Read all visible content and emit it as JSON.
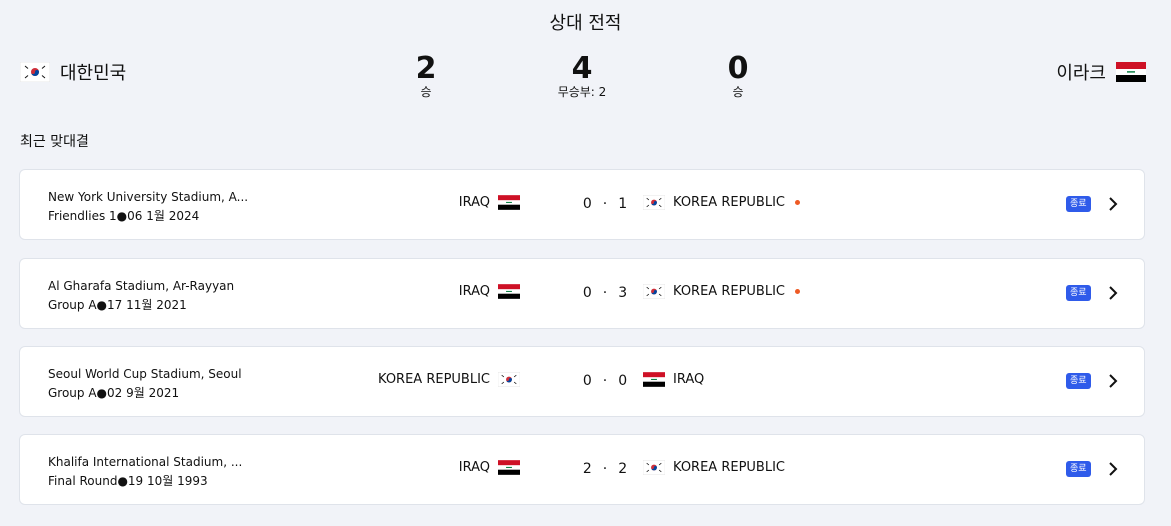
{
  "header": {
    "title": "상대 전적",
    "home_team": {
      "name": "대한민국",
      "flag": "korea-flag"
    },
    "away_team": {
      "name": "이라크",
      "flag": "iraq-flag"
    },
    "home_wins": {
      "value": "2",
      "label": "승"
    },
    "draws": {
      "value": "4",
      "label": "무승부: 2"
    },
    "away_wins": {
      "value": "0",
      "label": "승"
    }
  },
  "recent": {
    "title": "최근 맞대결",
    "matches": [
      {
        "venue": "New York University Stadium, A...",
        "info": "Friendlies 1●06 1월 2024",
        "left_team": "IRAQ",
        "left_flag": "iraq-flag",
        "left_score": "0",
        "separator": "·",
        "right_score": "1",
        "right_team": "KOREA REPUBLIC",
        "right_flag": "korea-flag",
        "winner_marker": true,
        "status": "종료"
      },
      {
        "venue": "Al Gharafa Stadium, Ar-Rayyan",
        "info": "Group A●17 11월 2021",
        "left_team": "IRAQ",
        "left_flag": "iraq-flag",
        "left_score": "0",
        "separator": "·",
        "right_score": "3",
        "right_team": "KOREA REPUBLIC",
        "right_flag": "korea-flag",
        "winner_marker": true,
        "status": "종료"
      },
      {
        "venue": "Seoul World Cup Stadium, Seoul",
        "info": "Group A●02 9월 2021",
        "left_team": "KOREA REPUBLIC",
        "left_flag": "korea-flag",
        "left_score": "0",
        "separator": "·",
        "right_score": "0",
        "right_team": "IRAQ",
        "right_flag": "iraq-flag",
        "winner_marker": false,
        "status": "종료"
      },
      {
        "venue": "Khalifa International Stadium, ...",
        "info": "Final Round●19 10월 1993",
        "left_team": "IRAQ",
        "left_flag": "iraq-flag",
        "left_score": "2",
        "separator": "·",
        "right_score": "2",
        "right_team": "KOREA REPUBLIC",
        "right_flag": "korea-flag",
        "winner_marker": false,
        "status": "종료"
      }
    ]
  },
  "colors": {
    "background": "#f1f3f8",
    "card": "#ffffff",
    "badge": "#2f5bea",
    "winner_marker": "#ee5a24"
  }
}
